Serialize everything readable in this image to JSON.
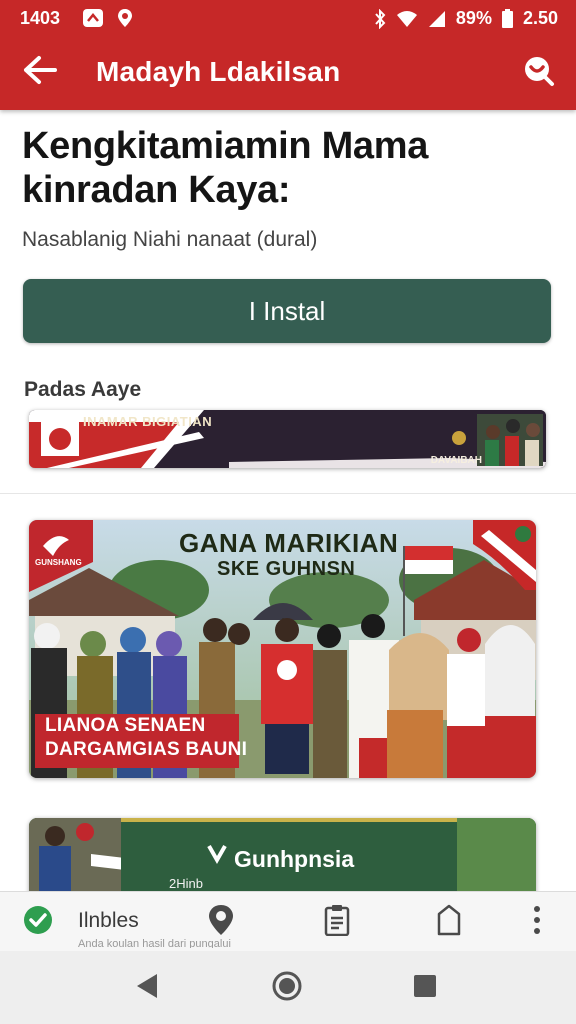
{
  "status_bar": {
    "time": "1403",
    "battery": "89%",
    "clock": "2.50"
  },
  "app_bar": {
    "title": "Madayh Ldakilsan",
    "back_icon": "arrow-left-icon",
    "search_icon": "search-icon"
  },
  "app": {
    "name": "Kengkitamiamin Mama kinradan Kaya:",
    "subtitle": "Nasablanig Niahi nanaat (dural)",
    "install_label": "I Instal"
  },
  "section": {
    "label": "Padas Aaye"
  },
  "banners": [
    {
      "text": "INAMAR BIGIATIAN",
      "caption": "DAVAIBAH"
    },
    {
      "title": "GANA MARIKIAN",
      "subtitle": "SKE GUHNSN",
      "caption_line1": "LIANOA SENAEN",
      "caption_line2": "DARGAMGIAS BAUNI",
      "brand": "GUNSHANG"
    },
    {
      "label": "Gunhpnsia",
      "sub": "2Hinb"
    }
  ],
  "bottom_toolbar": {
    "label": "Ilnbles",
    "sub": "Anda koulan hasil dari pungalui"
  },
  "colors": {
    "primary": "#c62828",
    "install": "#355e52",
    "check": "#2e9e4f"
  }
}
